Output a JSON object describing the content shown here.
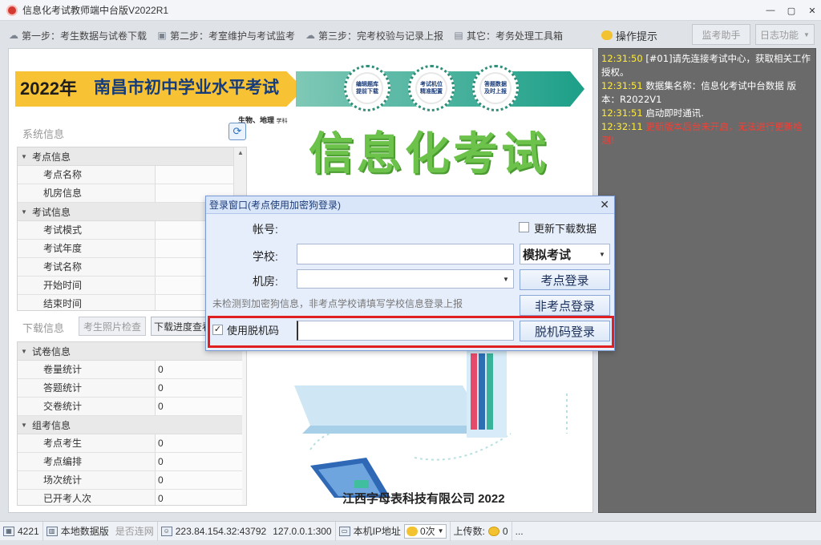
{
  "window": {
    "title": "信息化考试教师端中台版V2022R1",
    "minimize": "—",
    "restore": "▢",
    "close": "✕"
  },
  "toolbar": {
    "steps": [
      {
        "label": "第一步：考生数据与试卷下载",
        "icon": "cloud-download-icon"
      },
      {
        "label": "第二步：考室维护与考试监考",
        "icon": "monitor-icon"
      },
      {
        "label": "第三步：完考校验与记录上报",
        "icon": "cloud-upload-icon"
      },
      {
        "label": "其它：考务处理工具箱",
        "icon": "toolbox-icon"
      }
    ]
  },
  "banner": {
    "year": "2022年",
    "title": "南昌市初中学业水平考试",
    "subjects": "生物、地理",
    "subjects_suffix": "学科",
    "badges": [
      "编辑题库\n提前下载",
      "考试机位\n精准配置",
      "答题数据\n及时上报"
    ],
    "big_title": "信息化考试"
  },
  "system_info": {
    "label": "系统信息",
    "groups": [
      {
        "name": "考点信息",
        "rows": [
          {
            "k": "考点名称",
            "v": ""
          },
          {
            "k": "机房信息",
            "v": ""
          }
        ]
      },
      {
        "name": "考试信息",
        "rows": [
          {
            "k": "考试模式",
            "v": ""
          },
          {
            "k": "考试年度",
            "v": ""
          },
          {
            "k": "考试名称",
            "v": ""
          },
          {
            "k": "开始时间",
            "v": ""
          },
          {
            "k": "结束时间",
            "v": ""
          }
        ]
      }
    ]
  },
  "download_info": {
    "label": "下载信息",
    "photo_check": "考生照片检查",
    "progress_btn": "下载进度查看",
    "groups": [
      {
        "name": "试卷信息",
        "rows": [
          {
            "k": "卷量统计",
            "v": "0"
          },
          {
            "k": "答题统计",
            "v": "0"
          },
          {
            "k": "交卷统计",
            "v": "0"
          }
        ]
      },
      {
        "name": "组考信息",
        "rows": [
          {
            "k": "考点考生",
            "v": "0"
          },
          {
            "k": "考点编排",
            "v": "0"
          },
          {
            "k": "场次统计",
            "v": "0"
          },
          {
            "k": "已开考人次",
            "v": "0"
          }
        ]
      }
    ]
  },
  "company": "江西字母表科技有限公司 2022",
  "right_panel": {
    "title": "操作提示",
    "monitor_btn": "监考助手",
    "log_btn": "日志功能",
    "log": [
      {
        "ts": "12:31:50",
        "text": "[#01]请先连接考试中心，获取相关工作授权。",
        "error": false
      },
      {
        "ts": "12:31:51",
        "text": "数据集名称：信息化考试中台数据 版本：R2022V1",
        "error": false
      },
      {
        "ts": "12:31:51",
        "text": "启动即时通讯.",
        "error": false
      },
      {
        "ts": "12:32:11",
        "text": "更新版本后台未开启，无法进行更新检测!",
        "error": true
      }
    ]
  },
  "dialog": {
    "title": "登录窗口(考点使用加密狗登录)",
    "account_label": "帐号:",
    "school_label": "学校:",
    "room_label": "机房:",
    "update_download": "更新下载数据",
    "mode_value": "模拟考试",
    "site_login": "考点登录",
    "non_site_login": "非考点登录",
    "hint": "未检测到加密狗信息，非考点学校请填写学校信息登录上报",
    "offline_code_check": "使用脱机码",
    "offline_code_checked": true,
    "offline_login": "脱机码登录",
    "school_value": "",
    "room_value": "",
    "offline_code_value": ""
  },
  "statusbar": {
    "id": "4221",
    "local_db": "本地数据版",
    "connected": "是否连网",
    "server": "223.84.154.32:43792",
    "local": "127.0.0.1:300",
    "ip_label": "本机IP地址",
    "count": "0次",
    "upload_label": "上传数:",
    "upload_count": "0",
    "ellipsis": "..."
  }
}
